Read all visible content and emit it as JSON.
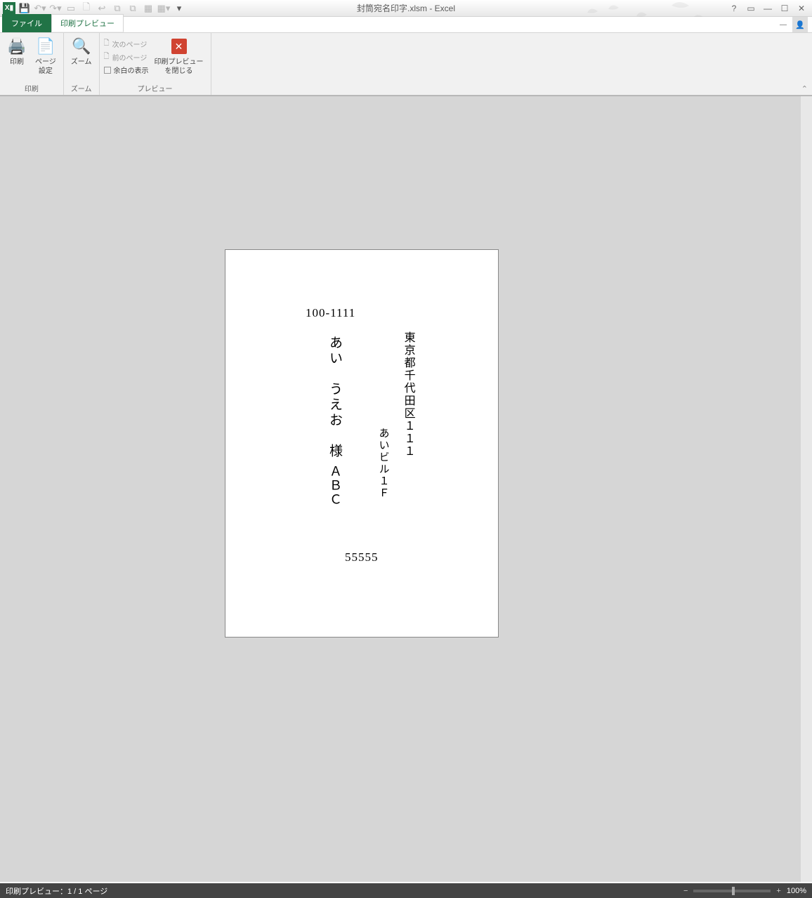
{
  "title": "封筒宛名印字.xlsm - Excel",
  "tabs": {
    "file": "ファイル",
    "print_preview": "印刷プレビュー"
  },
  "ribbon": {
    "group_print": "印刷",
    "group_zoom": "ズーム",
    "group_preview": "プレビュー",
    "print": "印刷",
    "page_setup": "ページ\n設定",
    "zoom": "ズーム",
    "next_page": "次のページ",
    "prev_page": "前のページ",
    "show_margins": "余白の表示",
    "close_preview": "印刷プレビュー\nを閉じる"
  },
  "envelope": {
    "postal": "100-1111",
    "address_line1": "東京都千代田区１１１",
    "address_line2": "あいビル１Ｆ",
    "company": "ＡＢＣ",
    "name": "あい　うえお　様",
    "bottom_number": "55555"
  },
  "status": {
    "left": "印刷プレビュー：1 / 1 ページ",
    "zoom": "100%"
  }
}
